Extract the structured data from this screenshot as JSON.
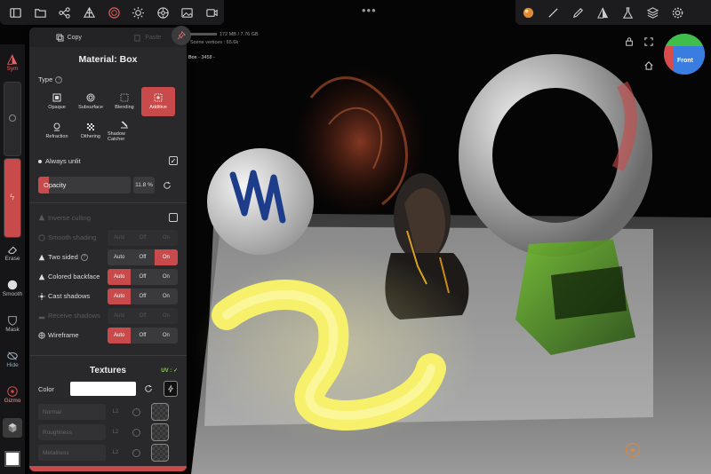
{
  "viewport": {
    "scene_vertices_label": "Scene vertices : 65.6k",
    "memory_label": "172 MB / 7.76 GB",
    "selected_object": "Box",
    "selected_object_vertices": "- 3458 -",
    "gizmo_front_label": "Front"
  },
  "toolbar": {
    "left_icons": [
      "folder-icon",
      "scene-graph-icon",
      "topology-icon",
      "material-icon",
      "light-icon",
      "settings-icon",
      "image-icon",
      "camera-icon"
    ],
    "right_icons": [
      "material-sphere-icon",
      "brush-icon",
      "pen-icon",
      "symmetry-icon",
      "flask-icon",
      "layers-icon",
      "gear-icon"
    ],
    "more_label": "•••"
  },
  "strip": {
    "top_tool_label": "Sym",
    "tools": [
      "Erase",
      "Smooth",
      "Mask",
      "Hide",
      "Gizmo"
    ]
  },
  "panel": {
    "tab_copy": "Copy",
    "tab_paste": "Paste",
    "title": "Material:  Box",
    "type_label": "Type",
    "types": [
      {
        "label": "Opaque",
        "icon": "opaque-icon",
        "selected": false
      },
      {
        "label": "Subsurface",
        "icon": "subsurface-icon",
        "selected": false
      },
      {
        "label": "Blending",
        "icon": "blending-icon",
        "selected": false
      },
      {
        "label": "Additive",
        "icon": "additive-icon",
        "selected": true
      },
      {
        "label": "Refraction",
        "icon": "refraction-icon",
        "selected": false
      },
      {
        "label": "Dithering",
        "icon": "dithering-icon",
        "selected": false
      },
      {
        "label": "Shadow Catcher",
        "icon": "shadow-catcher-icon",
        "selected": false
      }
    ],
    "always_unlit_label": "Always unlit",
    "always_unlit_checked": true,
    "opacity_label": "Opacity",
    "opacity_value": "11.8 %",
    "opacity_fraction": 0.118,
    "inverse_culling_label": "Inverse culling",
    "options": [
      {
        "label": "Smooth shading",
        "dim": true,
        "seg": [
          "Auto",
          "Off",
          "On"
        ],
        "active": -1
      },
      {
        "label": "Two sided",
        "dim": false,
        "seg": [
          "Auto",
          "Off",
          "On"
        ],
        "active": 2
      },
      {
        "label": "Colored backface",
        "dim": false,
        "seg": [
          "Auto",
          "Off",
          "On"
        ],
        "active": 0
      },
      {
        "label": "Cast shadows",
        "dim": false,
        "seg": [
          "Auto",
          "Off",
          "On"
        ],
        "active": 0
      },
      {
        "label": "Receive shadows",
        "dim": true,
        "seg": [
          "Auto",
          "Off",
          "On"
        ],
        "active": -1
      },
      {
        "label": "Wireframe",
        "dim": false,
        "seg": [
          "Auto",
          "Off",
          "On"
        ],
        "active": 0
      }
    ],
    "textures_title": "Textures",
    "uv_label": "UV : ✓",
    "color_label": "Color",
    "textures": [
      {
        "name": "Normal",
        "channel": "L2"
      },
      {
        "name": "Roughness",
        "channel": "L2"
      },
      {
        "name": "Metalness",
        "channel": "L2"
      }
    ]
  },
  "colors": {
    "accent": "#c84a4a",
    "panel_bg": "#29292b",
    "toolbar_bg": "#1c1c1e"
  }
}
